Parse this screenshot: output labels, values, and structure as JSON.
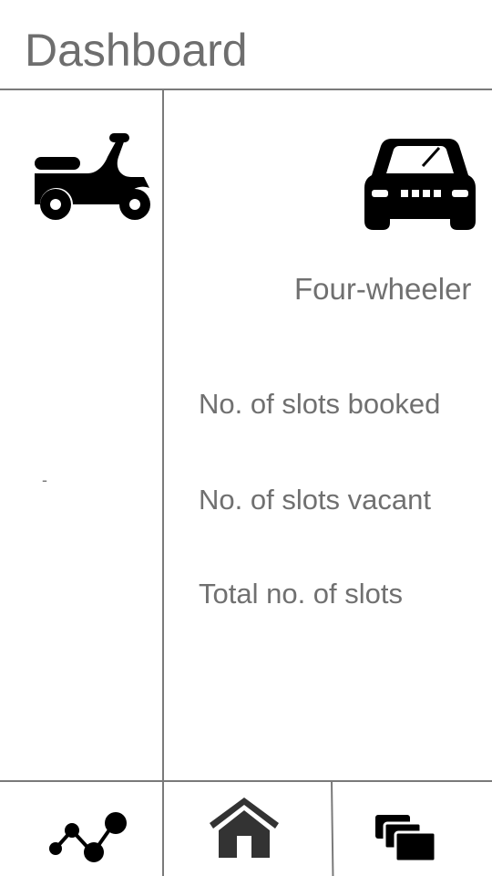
{
  "header": {
    "title": "Dashboard"
  },
  "left_panel": {
    "icon": "scooter-icon",
    "value": "-"
  },
  "right_panel": {
    "icon": "car-icon",
    "vehicle_type": "Four-wheeler",
    "stats": [
      {
        "label": "No. of slots booked"
      },
      {
        "label": "No. of slots vacant"
      },
      {
        "label": "Total no. of slots"
      }
    ]
  },
  "bottom_nav": [
    {
      "icon": "analytics-icon"
    },
    {
      "icon": "home-icon"
    },
    {
      "icon": "stacked-cards-icon"
    }
  ],
  "colors": {
    "lines": "#7a7a7a",
    "text": "#6e6e6e",
    "icons": "#000000",
    "home_icon": "#333333"
  }
}
